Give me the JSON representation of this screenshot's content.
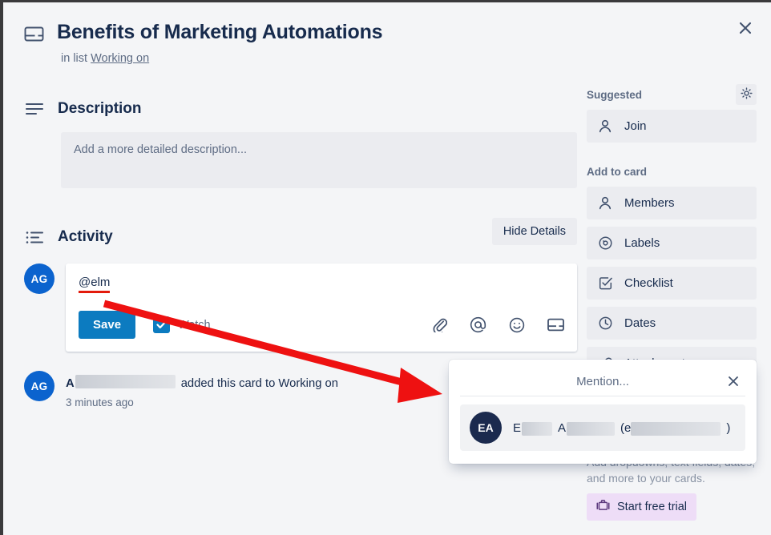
{
  "header": {
    "title": "Benefits of Marketing Automations",
    "in_list_prefix": "in list",
    "list_name": "Working on",
    "card_icon": "card-icon",
    "close_icon": "close-icon"
  },
  "description": {
    "section_title": "Description",
    "placeholder": "Add a more detailed description..."
  },
  "activity": {
    "section_title": "Activity",
    "hide_details_label": "Hide Details",
    "comment": {
      "avatar_initials": "AG",
      "value": "@elm",
      "save_label": "Save",
      "watch_label": "Watch",
      "watch_checked": true,
      "icons": [
        "attachment-icon",
        "mention-icon",
        "emoji-icon",
        "card-icon"
      ]
    },
    "entry": {
      "avatar_initials": "AG",
      "name_visible": "A",
      "name_redacted": true,
      "action_text": "added this card to Working on",
      "timestamp": "3 minutes ago"
    }
  },
  "sidebar": {
    "suggested_label": "Suggested",
    "settings_icon": "gear-icon",
    "suggested_items": [
      {
        "label": "Join",
        "icon": "person-icon"
      }
    ],
    "add_to_card_label": "Add to card",
    "add_to_card_items": [
      {
        "label": "Members",
        "icon": "person-icon"
      },
      {
        "label": "Labels",
        "icon": "label-icon"
      },
      {
        "label": "Checklist",
        "icon": "checklist-icon"
      },
      {
        "label": "Dates",
        "icon": "clock-icon"
      },
      {
        "label": "Attachment",
        "icon": "attachment-icon"
      }
    ]
  },
  "upsell": {
    "text": "Add dropdowns, text fields, dates, and more to your cards.",
    "button_label": "Start free trial",
    "button_icon": "briefcase-icon",
    "button_color": "#eeddf7"
  },
  "mention_popup": {
    "title": "Mention...",
    "close_icon": "close-icon",
    "results": [
      {
        "avatar_initials": "EA",
        "first_name_visible": "E",
        "last_name_visible": "A",
        "email_prefix": "(e",
        "email_suffix": ")",
        "redacted": true
      }
    ]
  },
  "annotation": {
    "arrow_color": "#ee1111",
    "underline_color": "#e31b0c"
  },
  "colors": {
    "accent_blue": "#0c7bc0",
    "avatar_blue": "#0b63ce",
    "text_primary": "#172b4d",
    "text_muted": "#5e6c84",
    "panel_bg": "#f4f5f7",
    "item_bg": "#ebecf0"
  }
}
